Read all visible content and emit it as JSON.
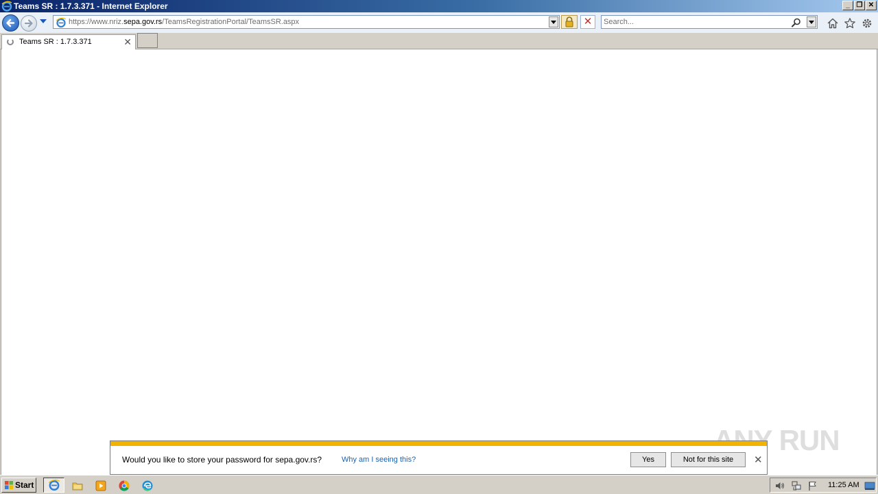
{
  "window": {
    "title": "Teams SR : 1.7.3.371 - Internet Explorer",
    "minimize": "_",
    "restore": "❐",
    "close": "✕"
  },
  "address_bar": {
    "url_prefix": "https://www.nriz.",
    "url_domain": "sepa.gov.rs",
    "url_path": "/TeamsRegistrationPortal/TeamsSR.aspx"
  },
  "toolbar": {
    "stop": "✕"
  },
  "search": {
    "placeholder": "Search..."
  },
  "tab": {
    "label": "Teams SR : 1.7.3.371",
    "close": "✕"
  },
  "notification": {
    "message": "Would you like to store your password for sepa.gov.rs?",
    "why_link": "Why am I seeing this?",
    "yes_button": "Yes",
    "not_for_site_button": "Not for this site",
    "close": "✕"
  },
  "watermark": {
    "text": "ANY RUN"
  },
  "taskbar": {
    "start_label": "Start",
    "clock": "11:25 AM"
  },
  "colors": {
    "notification_bar": "#f0b400",
    "link": "#1a62b0",
    "titlebar_start": "#0a246a"
  }
}
